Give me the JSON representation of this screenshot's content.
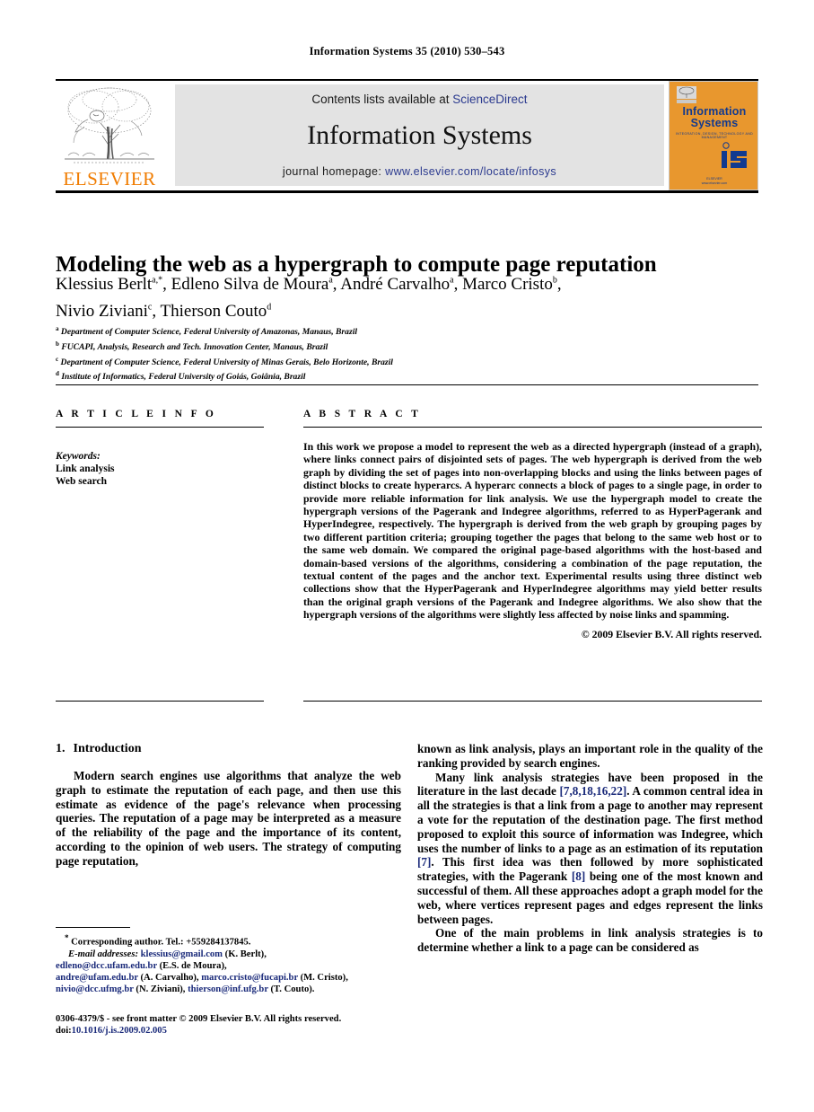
{
  "running_head": "Information Systems 35 (2010) 530–543",
  "banner": {
    "contents_prefix": "Contents lists available at",
    "sciencedirect": "ScienceDirect",
    "journal_title": "Information Systems",
    "homepage_prefix": "journal homepage:",
    "homepage_url": "www.elsevier.com/locate/infosys",
    "publisher_wordmark": "ELSEVIER",
    "cover": {
      "title_line1": "Information",
      "title_line2": "Systems",
      "subtitle": "INTEGRATION, DESIGN, TECHNOLOGY AND MANAGEMENT",
      "logo_text": "IS",
      "foot_line1": "ELSEVIER",
      "foot_line2": "www.elsevier.com"
    },
    "colors": {
      "link": "#2b3a8f",
      "elsevier_orange": "#F07C00",
      "banner_gray": "#e3e3e3",
      "cover_orange": "#E8972E",
      "cover_blue": "#123a8f"
    }
  },
  "article": {
    "title": "Modeling the web as a hypergraph to compute page reputation",
    "authors": [
      {
        "name": "Klessius Berlt",
        "marks": "a,*"
      },
      {
        "name": "Edleno Silva de Moura",
        "marks": "a"
      },
      {
        "name": "André Carvalho",
        "marks": "a"
      },
      {
        "name": "Marco Cristo",
        "marks": "b"
      },
      {
        "name": "Nivio Ziviani",
        "marks": "c"
      },
      {
        "name": "Thierson Couto",
        "marks": "d"
      }
    ],
    "affiliations": [
      {
        "mark": "a",
        "text": "Department of Computer Science, Federal University of Amazonas, Manaus, Brazil"
      },
      {
        "mark": "b",
        "text": "FUCAPI, Analysis, Research and Tech. Innovation Center, Manaus, Brazil"
      },
      {
        "mark": "c",
        "text": "Department of Computer Science, Federal University of Minas Gerais, Belo Horizonte, Brazil"
      },
      {
        "mark": "d",
        "text": "Institute of Informatics, Federal University of Goiás, Goiânia, Brazil"
      }
    ]
  },
  "article_info": {
    "heading": "A R T I C L E  I N F O",
    "keywords_label": "Keywords:",
    "keywords": [
      "Link analysis",
      "Web search"
    ]
  },
  "abstract": {
    "heading": "A B S T R A C T",
    "text": "In this work we propose a model to represent the web as a directed hypergraph (instead of a graph), where links connect pairs of disjointed sets of pages. The web hypergraph is derived from the web graph by dividing the set of pages into non-overlapping blocks and using the links between pages of distinct blocks to create hyperarcs. A hyperarc connects a block of pages to a single page, in order to provide more reliable information for link analysis. We use the hypergraph model to create the hypergraph versions of the Pagerank and Indegree algorithms, referred to as HyperPagerank and HyperIndegree, respectively. The hypergraph is derived from the web graph by grouping pages by two different partition criteria; grouping together the pages that belong to the same web host or to the same web domain. We compared the original page-based algorithms with the host-based and domain-based versions of the algorithms, considering a combination of the page reputation, the textual content of the pages and the anchor text. Experimental results using three distinct web collections show that the HyperPagerank and HyperIndegree algorithms may yield better results than the original graph versions of the Pagerank and Indegree algorithms. We also show that the hypergraph versions of the algorithms were slightly less affected by noise links and spamming.",
    "copyright": "© 2009 Elsevier B.V. All rights reserved."
  },
  "body": {
    "section_number": "1.",
    "section_title": "Introduction",
    "left_paragraph_1": "Modern search engines use algorithms that analyze the web graph to estimate the reputation of each page, and then use this estimate as evidence of the page's relevance when processing queries. The reputation of a page may be interpreted as a measure of the reliability of the page and the importance of its content, according to the opinion of web users. The strategy of computing page reputation,",
    "right_paragraph_1_cont": "known as link analysis, plays an important role in the quality of the ranking provided by search engines.",
    "right_paragraph_2_a": "Many link analysis strategies have been proposed in the literature in the last decade ",
    "right_cite_1": "[7,8,18,16,22]",
    "right_paragraph_2_b": ". A common central idea in all the strategies is that a link from a page to another may represent a vote for the reputation of the destination page. The first method proposed to exploit this source of information was Indegree, which uses the number of links to a page as an estimation of its reputation ",
    "right_cite_2": "[7]",
    "right_paragraph_2_c": ". This first idea was then followed by more sophisticated strategies, with the Pagerank ",
    "right_cite_3": "[8]",
    "right_paragraph_2_d": " being one of the most known and successful of them. All these approaches adopt a graph model for the web, where vertices represent pages and edges represent the links between pages.",
    "right_paragraph_3": "One of the main problems in link analysis strategies is to determine whether a link to a page can be considered as"
  },
  "footnotes": {
    "corresponding": "Corresponding author. Tel.: +559284137845.",
    "email_label": "E-mail addresses:",
    "emails": [
      {
        "address": "klessius@gmail.com",
        "owner": "(K. Berlt),"
      },
      {
        "address": "edleno@dcc.ufam.edu.br",
        "owner": "(E.S. de Moura),"
      },
      {
        "address": "andre@ufam.edu.br",
        "owner": "(A. Carvalho),"
      },
      {
        "address": "marco.cristo@fucapi.br",
        "owner": "(M. Cristo),"
      },
      {
        "address": "nivio@dcc.ufmg.br",
        "owner": "(N. Ziviani),"
      },
      {
        "address": "thierson@inf.ufg.br",
        "owner": "(T. Couto)."
      }
    ]
  },
  "imprint": {
    "issn_line": "0306-4379/$ - see front matter © 2009 Elsevier B.V. All rights reserved.",
    "doi_prefix": "doi:",
    "doi": "10.1016/j.is.2009.02.005"
  }
}
